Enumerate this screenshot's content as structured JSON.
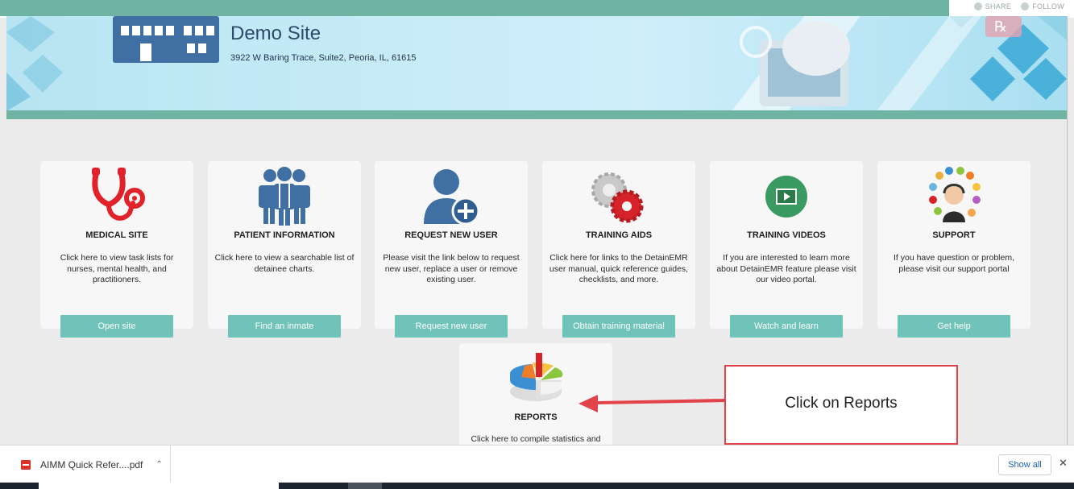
{
  "topbar": {
    "share_label": "SHARE",
    "follow_label": "FOLLOW"
  },
  "site": {
    "title": "Demo Site",
    "address": "3922 W Baring Trace, Suite2, Peoria, IL, 61615"
  },
  "cards": [
    {
      "title": "MEDICAL SITE",
      "description": "Click here to view task lists for nurses, mental health, and practitioners.",
      "button": "Open site",
      "icon": "stethoscope-icon"
    },
    {
      "title": "PATIENT INFORMATION",
      "description": "Click here to view a searchable list of detainee charts.",
      "button": "Find an inmate",
      "icon": "people-group-icon"
    },
    {
      "title": "REQUEST NEW USER",
      "description": "Please visit the link below to request new user, replace a user or remove existing user.",
      "button": "Request new user",
      "icon": "add-user-icon"
    },
    {
      "title": "TRAINING AIDS",
      "description": "Click here for links to the DetainEMR user manual, quick reference guides, checklists, and more.",
      "button": "Obtain training material",
      "icon": "gears-icon"
    },
    {
      "title": "TRAINING VIDEOS",
      "description": "If you are interested to learn more about DetainEMR feature please visit our video portal.",
      "button": "Watch and learn",
      "icon": "video-player-icon"
    },
    {
      "title": "SUPPORT",
      "description": "If you have question or problem, please visit our support portal",
      "button": "Get help",
      "icon": "support-agent-icon"
    }
  ],
  "reports": {
    "title": "REPORTS",
    "description": "Click here to compile statistics and",
    "icon": "pie-chart-icon"
  },
  "annotation": {
    "text": "Click on Reports"
  },
  "download_bar": {
    "file_name": "AIMM Quick Refer....pdf",
    "show_all": "Show all"
  },
  "colors": {
    "accent_teal": "#6fb3a3",
    "button_teal": "#6fc3b8",
    "callout_red": "#e2424a"
  }
}
